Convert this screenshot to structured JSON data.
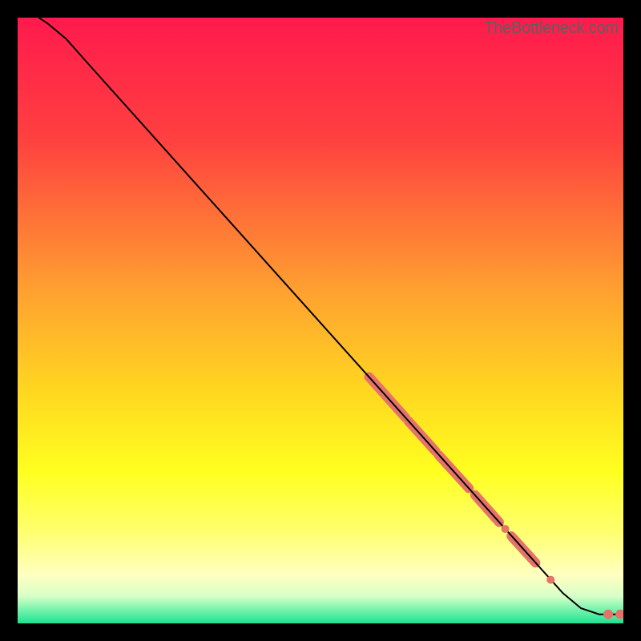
{
  "watermark": "TheBottleneck.com",
  "chart_data": {
    "type": "line",
    "title": "",
    "xlabel": "",
    "ylabel": "",
    "xlim": [
      0,
      100
    ],
    "ylim": [
      0,
      100
    ],
    "background_gradient_stops": [
      {
        "offset": 0.0,
        "color": "#ff1a4d"
      },
      {
        "offset": 0.2,
        "color": "#ff4040"
      },
      {
        "offset": 0.45,
        "color": "#ffa030"
      },
      {
        "offset": 0.62,
        "color": "#ffd820"
      },
      {
        "offset": 0.75,
        "color": "#ffff20"
      },
      {
        "offset": 0.85,
        "color": "#ffff70"
      },
      {
        "offset": 0.92,
        "color": "#ffffc0"
      },
      {
        "offset": 0.955,
        "color": "#d8ffc8"
      },
      {
        "offset": 0.975,
        "color": "#80f5b0"
      },
      {
        "offset": 1.0,
        "color": "#20e090"
      }
    ],
    "curve": [
      {
        "x": 3.5,
        "y": 100.0
      },
      {
        "x": 5.0,
        "y": 99.0
      },
      {
        "x": 8.0,
        "y": 96.5
      },
      {
        "x": 12.0,
        "y": 92.0
      },
      {
        "x": 90.0,
        "y": 5.0
      },
      {
        "x": 93.0,
        "y": 2.5
      },
      {
        "x": 96.0,
        "y": 1.5
      },
      {
        "x": 99.5,
        "y": 1.5
      }
    ],
    "highlight_color": "#e57369",
    "highlight_segments": [
      {
        "x1": 58,
        "y1": 40.7,
        "x2": 64,
        "y2": 34.0,
        "w": 12
      },
      {
        "x1": 64.5,
        "y1": 33.4,
        "x2": 69,
        "y2": 28.4,
        "w": 12
      },
      {
        "x1": 69.5,
        "y1": 27.8,
        "x2": 74.5,
        "y2": 22.3,
        "w": 12
      },
      {
        "x1": 75.5,
        "y1": 21.2,
        "x2": 79.5,
        "y2": 16.7,
        "w": 12
      },
      {
        "x1": 81.5,
        "y1": 14.4,
        "x2": 85.5,
        "y2": 10.0,
        "w": 12
      }
    ],
    "highlight_points": [
      {
        "x": 80.5,
        "y": 15.6,
        "r": 5
      },
      {
        "x": 88.0,
        "y": 7.2,
        "r": 5
      },
      {
        "x": 97.5,
        "y": 1.5,
        "r": 6
      },
      {
        "x": 99.5,
        "y": 1.5,
        "r": 6
      }
    ]
  }
}
